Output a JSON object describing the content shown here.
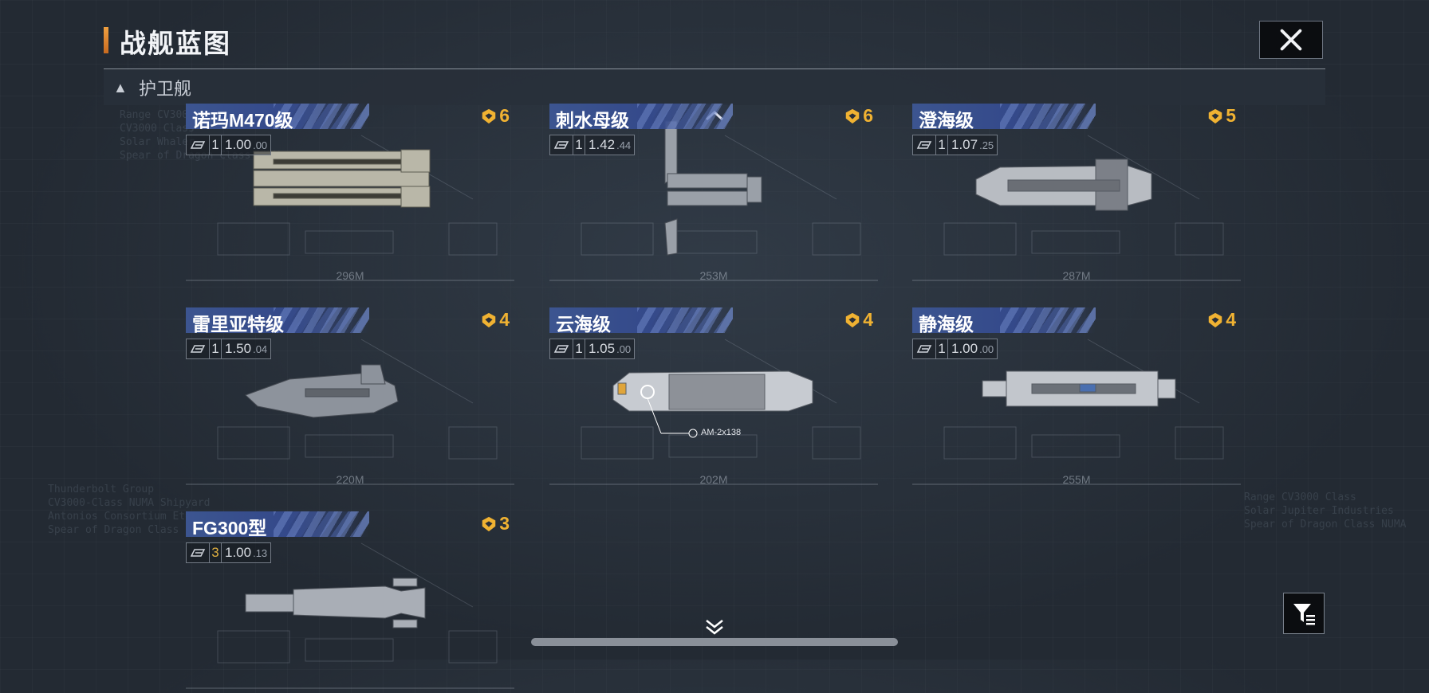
{
  "page_title": "战舰蓝图",
  "section": {
    "label": "护卫舰",
    "expand_icon": "collapse-triangle-icon"
  },
  "ships": [
    {
      "name": "诺玛M470级",
      "rank": "6",
      "type_icon": "carrier-type-icon",
      "tier": "1",
      "ratio_main": "1.00",
      "ratio_sub": ".00",
      "length": "296M"
    },
    {
      "name": "刺水母级",
      "rank": "6",
      "type_icon": "carrier-type-icon",
      "tier": "1",
      "ratio_main": "1.42",
      "ratio_sub": ".44",
      "length": "253M"
    },
    {
      "name": "澄海级",
      "rank": "5",
      "type_icon": "support-type-icon",
      "tier": "1",
      "ratio_main": "1.07",
      "ratio_sub": ".25",
      "length": "287M"
    },
    {
      "name": "雷里亚特级",
      "rank": "4",
      "type_icon": "fighter-type-icon",
      "tier": "1",
      "ratio_main": "1.50",
      "ratio_sub": ".04",
      "length": "220M"
    },
    {
      "name": "云海级",
      "rank": "4",
      "type_icon": "support-type-icon",
      "tier": "1",
      "ratio_main": "1.05",
      "ratio_sub": ".00",
      "length": "202M",
      "annotation": "AM-2x138"
    },
    {
      "name": "静海级",
      "rank": "4",
      "type_icon": "support-type-icon",
      "tier": "1",
      "ratio_main": "1.00",
      "ratio_sub": ".00",
      "length": "255M"
    },
    {
      "name": "FG300型",
      "rank": "3",
      "type_icon": "globe-type-icon",
      "tier": "3",
      "ratio_main": "1.00",
      "ratio_sub": ".13",
      "length": ""
    }
  ],
  "colors": {
    "rank": "#f0b232",
    "namebar": "#3c5590",
    "accent": "#f0a040"
  }
}
